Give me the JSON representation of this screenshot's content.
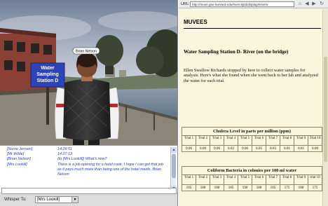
{
  "scene": {
    "name_tag": "Brian Nelson",
    "station_sign": [
      "Water",
      "Sampling",
      "Station D"
    ]
  },
  "chat": {
    "lines": [
      {
        "who": "[Nurse Jensen]",
        "msg": "14:26:51"
      },
      {
        "who": "[Mr Wilde]",
        "msg": "14:27:13"
      },
      {
        "who": "[Brian Nelson]",
        "msg": "(to [Mrs Lookill]) What's new?"
      },
      {
        "who": "[Mrs Lookill]",
        "msg": "There is a job opening for a hotel cook. I hope I can get that job as it pays much more than being one of the hotel maids, Brian Nelson"
      }
    ]
  },
  "whisper": {
    "label": "Whisper To:",
    "target": "[Mrs Lookill]"
  },
  "browser": {
    "url_label": "URL:",
    "url": "http://muve.gse.harvard.edu/rivercitytd/display/envirw"
  },
  "page": {
    "site_title": "MUVEES",
    "station_heading": "Water Sampling Station D- River (on the bridge)",
    "intro": "Ellen Swallow Richards stopped by here to collect water samples for analysis. Here's what she found when she went back to her lab and analyzed the water for each trial.",
    "tables": [
      {
        "title": "Cholera Level in parts per million (ppm)",
        "headers": [
          "Trial 1",
          "Trial 2",
          "Trial 3",
          "Trial 4",
          "Trial 5",
          "Trial 6",
          "Trial 7",
          "Trial 8",
          "Trial 9",
          "Trial 10"
        ],
        "values": [
          "0.00",
          "0.00",
          "0.00",
          "0.02",
          "0.06",
          "0.05",
          "0.03",
          "0.01",
          "0.01",
          "0.00"
        ]
      },
      {
        "title": "Coliform Bacteria in colonies per 100 ml water",
        "headers": [
          "Trial 1",
          "Trial 2",
          "Trial 3",
          "Trial 4",
          "Trial 5",
          "Trial 6",
          "Trial 7",
          "Trial 8",
          "Trial 9",
          "trial 10"
        ],
        "values": [
          "185",
          "180",
          "180",
          "185",
          "190",
          "180",
          "185",
          "175",
          "180",
          "175"
        ]
      }
    ]
  },
  "colors": {
    "page_background": "#faf6dd",
    "chat_text": "#2a3fb5",
    "sign_blue": "#2f43b8"
  }
}
